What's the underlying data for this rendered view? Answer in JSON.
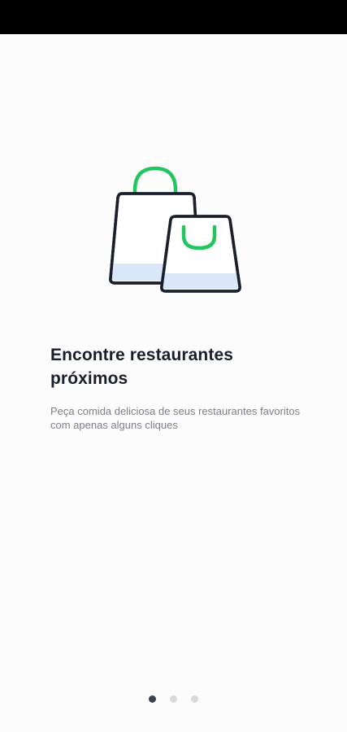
{
  "onboarding": {
    "title": "Encontre restaurantes próximos",
    "subtitle": "Peça comida deliciosa de seus restaurantes favoritos com apenas alguns cliques",
    "illustration": "shopping-bags-icon",
    "page_count": 3,
    "current_page": 1
  },
  "colors": {
    "accent": "#22c55e",
    "outline": "#1b1f2b",
    "bag_fill": "#ffffff",
    "bag_shade": "#dbe6f8",
    "dot_active": "#3b4250",
    "dot_inactive": "#d6d8dc"
  }
}
